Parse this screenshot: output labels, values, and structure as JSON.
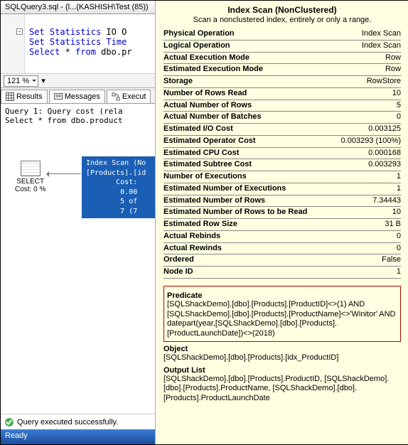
{
  "title": "SQLQuery3.sql - (l...(KASHISH\\Test (85))",
  "code": {
    "line1_kw1": "Set",
    "line1_kw2": "Statistics",
    "line1_rest": " IO O",
    "line2_kw1": "Set",
    "line2_kw2": "Statistics",
    "line2_kw3": "Time",
    "line3_kw1": "Select",
    "line3_rest": " * ",
    "line3_kw2": "from",
    "line3_rest2": " dbo.pr"
  },
  "zoom": "121 %",
  "tabs": {
    "results": "Results",
    "messages": "Messages",
    "execplan": "Execut"
  },
  "query_text1": "Query 1: Query cost (rela",
  "query_text2": "Select * from dbo.product",
  "op_select": {
    "label": "SELECT",
    "cost": "Cost: 0 %"
  },
  "op_scan": "Index Scan (No\n[Products].[id\n       Cost: \n        0.00\n        5 of\n        7 (7",
  "status": "Query executed successfully.",
  "ready": "Ready",
  "tooltip": {
    "title": "Index Scan (NonClustered)",
    "subtitle": "Scan a nonclustered index, entirely or only a range.",
    "rows": [
      {
        "k": "Physical Operation",
        "v": "Index Scan"
      },
      {
        "k": "Logical Operation",
        "v": "Index Scan"
      },
      {
        "k": "Actual Execution Mode",
        "v": "Row"
      },
      {
        "k": "Estimated Execution Mode",
        "v": "Row"
      },
      {
        "k": "Storage",
        "v": "RowStore"
      },
      {
        "k": "Number of Rows Read",
        "v": "10"
      },
      {
        "k": "Actual Number of Rows",
        "v": "5"
      },
      {
        "k": "Actual Number of Batches",
        "v": "0"
      },
      {
        "k": "Estimated I/O Cost",
        "v": "0.003125"
      },
      {
        "k": "Estimated Operator Cost",
        "v": "0.003293 (100%)"
      },
      {
        "k": "Estimated CPU Cost",
        "v": "0.000168"
      },
      {
        "k": "Estimated Subtree Cost",
        "v": "0.003293"
      },
      {
        "k": "Number of Executions",
        "v": "1"
      },
      {
        "k": "Estimated Number of Executions",
        "v": "1"
      },
      {
        "k": "Estimated Number of Rows",
        "v": "7.34443"
      },
      {
        "k": "Estimated Number of Rows to be Read",
        "v": "10"
      },
      {
        "k": "Estimated Row Size",
        "v": "31 B"
      },
      {
        "k": "Actual Rebinds",
        "v": "0"
      },
      {
        "k": "Actual Rewinds",
        "v": "0"
      },
      {
        "k": "Ordered",
        "v": "False"
      },
      {
        "k": "Node ID",
        "v": "1"
      }
    ],
    "predicate_label": "Predicate",
    "predicate_text": "[SQLShackDemo].[dbo].[Products].[ProductID]<>(1) AND [SQLShackDemo].[dbo].[Products].[ProductName]<>'Winitor' AND datepart(year,[SQLShackDemo].[dbo].[Products].[ProductLaunchDate])<>(2018)",
    "object_label": "Object",
    "object_text": "[SQLShackDemo].[dbo].[Products].[idx_ProductID]",
    "output_label": "Output List",
    "output_text": "[SQLShackDemo].[dbo].[Products].ProductID, [SQLShackDemo].[dbo].[Products].ProductName, [SQLShackDemo].[dbo].[Products].ProductLaunchDate"
  }
}
